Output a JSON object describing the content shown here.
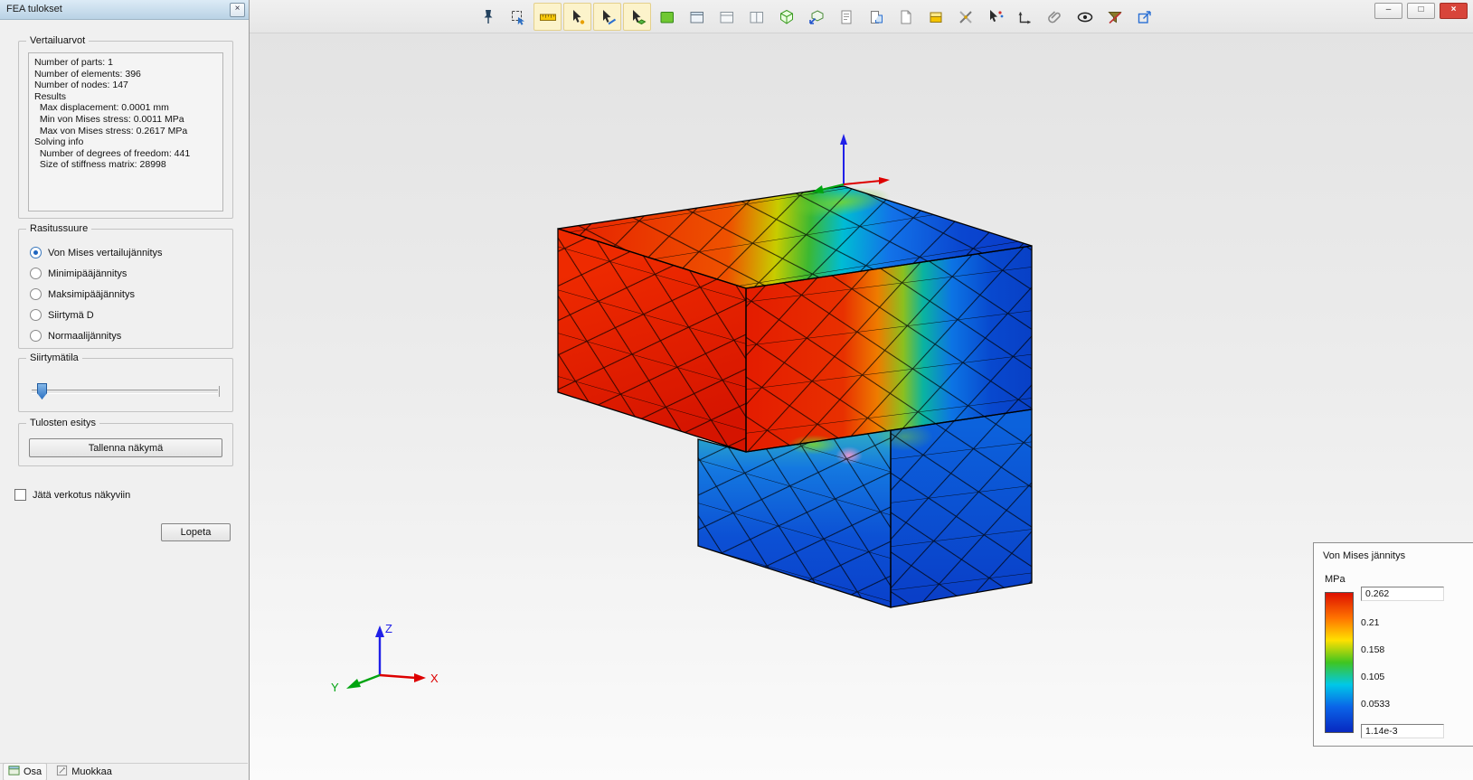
{
  "window": {
    "controls": {
      "minimize": "–",
      "maximize": "□",
      "close": "×"
    }
  },
  "toolbar": {
    "icons": [
      {
        "name": "pin-icon",
        "highlighted": false
      },
      {
        "name": "zoom-select-icon",
        "highlighted": false
      },
      {
        "name": "ruler-icon",
        "highlighted": true
      },
      {
        "name": "snap-point-icon",
        "highlighted": true
      },
      {
        "name": "snap-edge-icon",
        "highlighted": true
      },
      {
        "name": "snap-face-icon",
        "highlighted": true
      },
      {
        "name": "view-shaded-icon",
        "highlighted": false
      },
      {
        "name": "view-pane1-icon",
        "highlighted": false
      },
      {
        "name": "view-pane2-icon",
        "highlighted": false
      },
      {
        "name": "view-pane3-icon",
        "highlighted": false
      },
      {
        "name": "view-iso-icon",
        "highlighted": false
      },
      {
        "name": "view-orient-icon",
        "highlighted": false
      },
      {
        "name": "notes-icon",
        "highlighted": false
      },
      {
        "name": "clipboard-icon",
        "highlighted": false
      },
      {
        "name": "sketch-icon",
        "highlighted": false
      },
      {
        "name": "layers-icon",
        "highlighted": false
      },
      {
        "name": "trim-icon",
        "highlighted": false
      },
      {
        "name": "pick-special-icon",
        "highlighted": false
      },
      {
        "name": "dimension-icon",
        "highlighted": false
      },
      {
        "name": "attach-icon",
        "highlighted": false
      },
      {
        "name": "visibility-icon",
        "highlighted": false
      },
      {
        "name": "filter-icon",
        "highlighted": false
      },
      {
        "name": "export-icon",
        "highlighted": false
      }
    ]
  },
  "panel": {
    "title": "FEA tulokset",
    "close_label": "×",
    "groups": {
      "vertailuarvot": {
        "label": "Vertailuarvot",
        "lines": [
          "Number of parts: 1",
          "Number of elements: 396",
          "Number of nodes: 147",
          "Results",
          "  Max displacement: 0.0001 mm",
          "  Min von Mises stress: 0.0011 MPa",
          "  Max von Mises stress: 0.2617 MPa",
          "Solving info",
          "  Number of degrees of freedom: 441",
          "  Size of stiffness matrix: 28998"
        ]
      },
      "rasitussuure": {
        "label": "Rasitussuure",
        "options": [
          {
            "label": "Von Mises vertailujännitys",
            "selected": true
          },
          {
            "label": "Minimipääjännitys",
            "selected": false
          },
          {
            "label": "Maksimipääjännitys",
            "selected": false
          },
          {
            "label": "Siirtymä D",
            "selected": false
          },
          {
            "label": "Normaalijännitys",
            "selected": false
          }
        ]
      },
      "siirtymatila": {
        "label": "Siirtymätila",
        "slider_position_percent": 3
      },
      "tulosten_esitys": {
        "label": "Tulosten esitys",
        "button": "Tallenna näkymä"
      }
    },
    "mesh_checkbox": {
      "label": "Jätä verkotus näkyviin",
      "checked": false
    },
    "lopeta_button": "Lopeta",
    "bottom_tabs": [
      {
        "label": "Osa",
        "icon": "osa-icon"
      },
      {
        "label": "Muokkaa",
        "icon": "muokkaa-icon"
      }
    ]
  },
  "viewport": {
    "axes": {
      "x": "X",
      "y": "Y",
      "z": "Z",
      "x_color": "#dd0000",
      "y_color": "#00a410",
      "z_color": "#2020e8"
    },
    "legend": {
      "title": "Von Mises jännitys",
      "unit": "MPa",
      "values": [
        "0.262",
        "0.21",
        "0.158",
        "0.105",
        "0.0533",
        "1.14e-3"
      ]
    }
  },
  "colors": {
    "stress_colormap": [
      "#dd1000",
      "#ff7300",
      "#ffe000",
      "#3fc520",
      "#00c8e8",
      "#0a64e8",
      "#0828c0"
    ],
    "panel_titlebar": "#c5d9ea",
    "close_button": "#d8453a"
  }
}
